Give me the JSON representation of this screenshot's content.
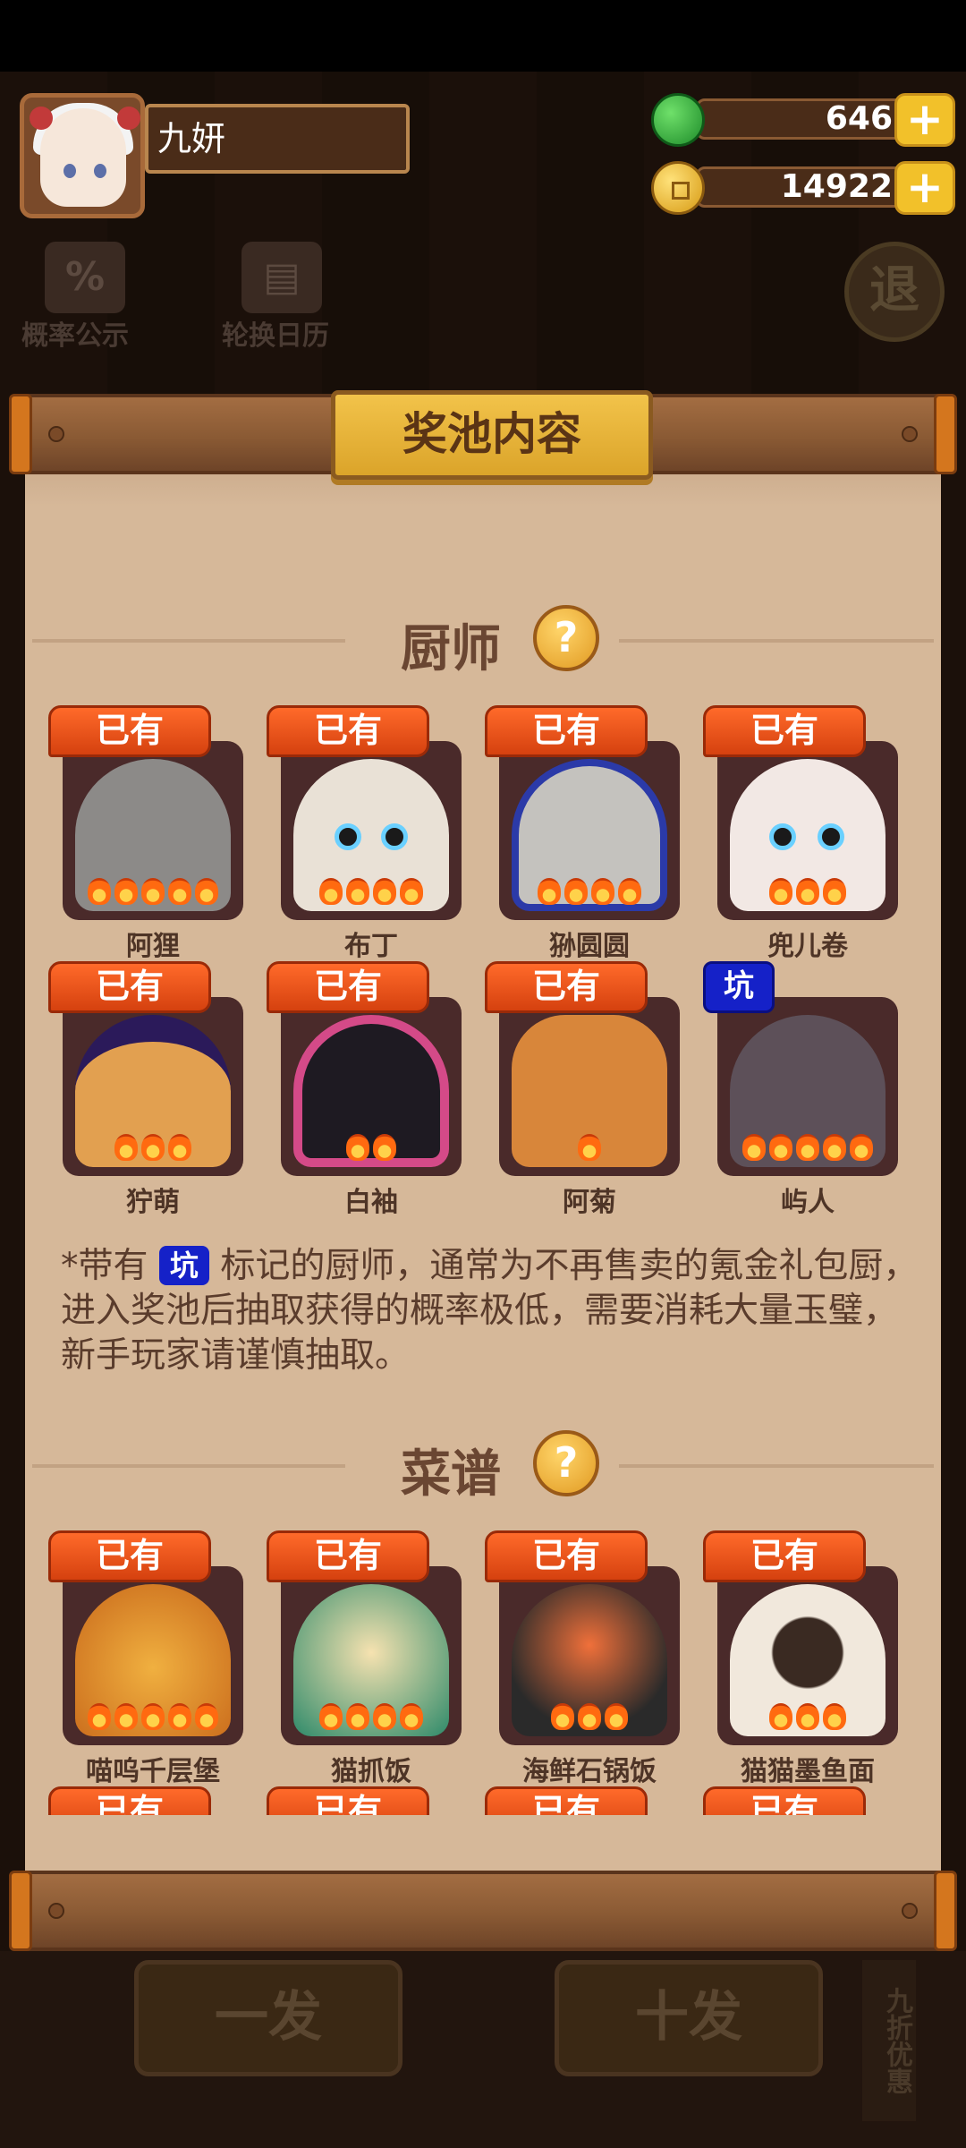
{
  "player": {
    "name": "九妍"
  },
  "resources": {
    "jade": "646",
    "coins": "14922",
    "plus_label": "+"
  },
  "background": {
    "probability_label": "概率公示",
    "rotation_calendar_label": "轮换日历",
    "exit_label": "退",
    "one_draw_label": "一发",
    "ten_draw_label": "十发",
    "discount_label": "九折优惠"
  },
  "dialog": {
    "title": "奖池内容",
    "chefs_section": {
      "title": "厨师",
      "help": "?",
      "items": [
        {
          "name": "阿狸",
          "tag": "已有",
          "flames": 5
        },
        {
          "name": "布丁",
          "tag": "已有",
          "flames": 4
        },
        {
          "name": "狲圆圆",
          "tag": "已有",
          "flames": 4
        },
        {
          "name": "兜儿卷",
          "tag": "已有",
          "flames": 3
        },
        {
          "name": "狞萌",
          "tag": "已有",
          "flames": 3
        },
        {
          "name": "白袖",
          "tag": "已有",
          "flames": 2
        },
        {
          "name": "阿菊",
          "tag": "已有",
          "flames": 1
        },
        {
          "name": "屿人",
          "tag": "坑",
          "flames": 5
        }
      ],
      "note_prefix": "*带有",
      "note_tag": "坑",
      "note_text": "标记的厨师，通常为不再售卖的氪金礼包厨，进入奖池后抽取获得的概率极低，需要消耗大量玉璧，新手玩家请谨慎抽取。"
    },
    "recipes_section": {
      "title": "菜谱",
      "help": "?",
      "items": [
        {
          "name": "喵呜千层堡",
          "tag": "已有",
          "flames": 5
        },
        {
          "name": "猫抓饭",
          "tag": "已有",
          "flames": 4
        },
        {
          "name": "海鲜石锅饭",
          "tag": "已有",
          "flames": 3
        },
        {
          "name": "猫猫墨鱼面",
          "tag": "已有",
          "flames": 3
        }
      ],
      "next_row_tags": [
        "已有",
        "已有",
        "已有",
        "已有"
      ]
    }
  },
  "colors": {
    "accent_orange": "#d5410f",
    "pit_blue": "#1521c8",
    "parchment": "#d6b899",
    "gold": "#f2c12a"
  }
}
